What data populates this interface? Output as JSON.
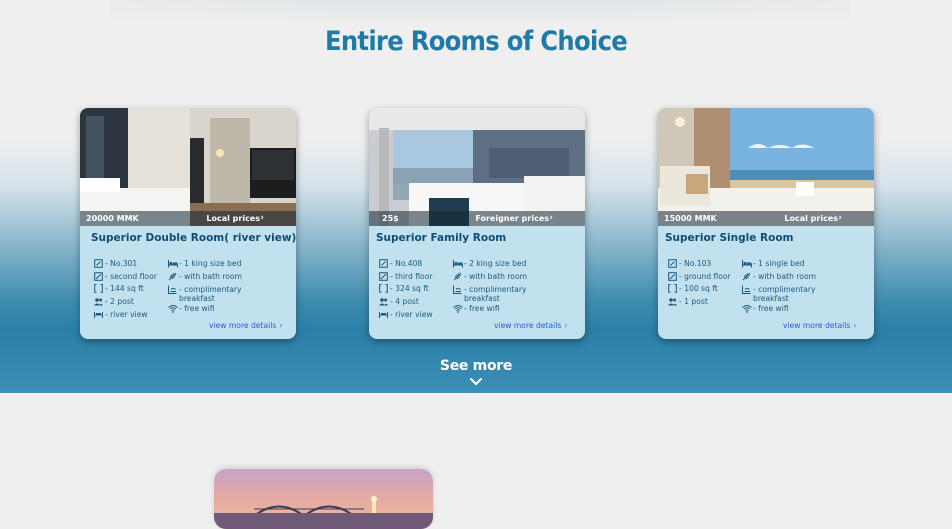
{
  "section": {
    "title": "Entire Rooms of Choice",
    "see_more": "See more"
  },
  "rooms": [
    {
      "price": "20000 MMK",
      "price_type": "Local prices",
      "name": "Superior Double Room( river view)",
      "features_left": [
        "- No.301",
        "- second floor",
        "- 144 sq ft",
        "- 2 post",
        "- river view"
      ],
      "features_right": [
        "- 1 king size bed",
        "- with bath room",
        "- complimentary breakfast",
        "- free wifi"
      ],
      "view_more": "view more details"
    },
    {
      "price": "25$",
      "price_type": "Foreigner prices",
      "name": "Superior Family Room",
      "features_left": [
        "- No.408",
        "- third floor",
        "- 324 sq ft",
        "- 4 post",
        "- river view"
      ],
      "features_right": [
        "- 2 king size bed",
        "- with bath room",
        "- complimentary breakfast",
        "- free wifi"
      ],
      "view_more": "view more details"
    },
    {
      "price": "15000 MMK",
      "price_type": "Local prices",
      "name": "Superior Single Room",
      "features_left": [
        "- No.103",
        "- ground floor",
        "- 100 sq ft",
        "- 1 post"
      ],
      "features_right": [
        "- 1 single bed",
        "- with bath room",
        "- complimentary breakfast",
        "- free wifi"
      ],
      "view_more": "view more details"
    }
  ],
  "icons": {
    "left": [
      "door-number-icon",
      "floor-icon",
      "area-bracket-icon",
      "people-icon",
      "view-icon"
    ],
    "right": [
      "bed-icon",
      "bath-icon",
      "breakfast-icon",
      "wifi-icon"
    ]
  },
  "colors": {
    "title": "#1f7aa6",
    "card_bg": "#c2e1ee",
    "room_name": "#0e4d73",
    "link": "#2a5bd0",
    "section_blue": "#2a80a7"
  }
}
